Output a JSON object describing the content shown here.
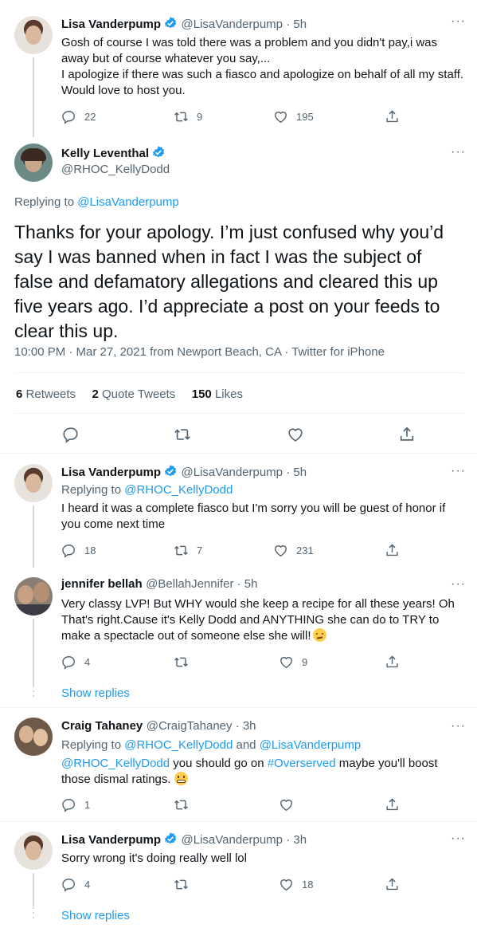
{
  "tweet1": {
    "name": "Lisa Vanderpump",
    "handle": "@LisaVanderpump · 5h",
    "line1": "Gosh of course I was told there was a problem and you didn't pay,i was away but of course whatever you say,...",
    "line2": "I apologize if there was such a fiasco and apologize on behalf of all my staff. Would love to host you.",
    "replies": "22",
    "retweets": "9",
    "likes": "195"
  },
  "main": {
    "name": "Kelly Leventhal",
    "handle": "@RHOC_KellyDodd",
    "replying_label": "Replying to",
    "replying_to": "@LisaVanderpump",
    "text": "Thanks for your apology. I’m just confused why you’d say I was banned when in fact I was the subject of false and defamatory allegations and cleared this up five years ago. I’d appreciate a post on your feeds to clear this up.",
    "meta": "10:00 PM · Mar 27, 2021 from Newport Beach, CA · Twitter for iPhone",
    "retweets_count": "6",
    "retweets_label": "Retweets",
    "quote_count": "2",
    "quote_label": "Quote Tweets",
    "likes_count": "150",
    "likes_label": "Likes"
  },
  "reply1": {
    "name": "Lisa Vanderpump",
    "handle": "@LisaVanderpump · 5h",
    "replying_label": "Replying to",
    "replying_to": "@RHOC_KellyDodd",
    "text": "I heard it was a complete fiasco but I'm sorry you will be guest of honor if you come next time",
    "replies": "18",
    "retweets": "7",
    "likes": "231"
  },
  "reply2": {
    "name": "jennifer bellah",
    "handle": "@BellahJennifer · 5h",
    "text": "Very classy LVP! But WHY would she keep a recipe for all these years! Oh That's right.Cause it's Kelly Dodd and ANYTHING she can do to TRY to make a spectacle out of someone else she will!",
    "replies": "4",
    "retweets": "",
    "likes": "9",
    "show_replies": "Show replies"
  },
  "reply3": {
    "name": "Craig Tahaney",
    "handle": "@CraigTahaney · 3h",
    "replying_label": "Replying to",
    "replying_to_1": "@RHOC_KellyDodd",
    "and": "and",
    "replying_to_2": "@LisaVanderpump",
    "mention": "@RHOC_KellyDodd",
    "text_a": "you should go on",
    "hashtag": "#Overserved",
    "text_b": "maybe you'll boost those dismal ratings.",
    "replies": "1",
    "retweets": "",
    "likes": ""
  },
  "reply4": {
    "name": "Lisa Vanderpump",
    "handle": "@LisaVanderpump · 3h",
    "text": "Sorry wrong it's doing really well lol",
    "replies": "4",
    "retweets": "",
    "likes": "18",
    "show_replies": "Show replies"
  },
  "colors": {
    "accent": "#1d9bf0",
    "muted": "#536471",
    "text": "#0f1419"
  },
  "icons": {
    "reply": "reply-icon",
    "retweet": "retweet-icon",
    "like": "heart-icon",
    "share": "share-icon",
    "verified": "verified-badge-icon",
    "more": "more-icon"
  }
}
